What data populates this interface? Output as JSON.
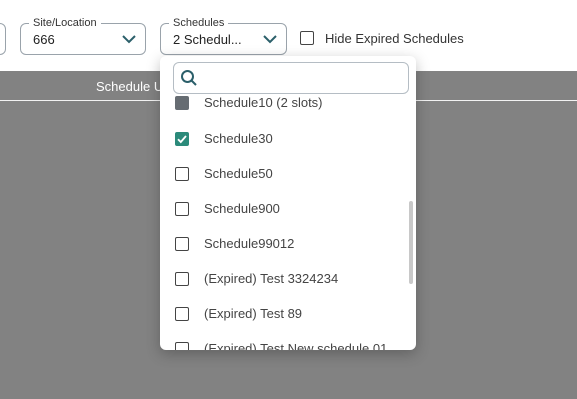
{
  "filters": {
    "site_location": {
      "label": "Site/Location",
      "value": "666"
    },
    "schedules": {
      "label": "Schedules",
      "value": "2 Schedul..."
    },
    "hide_expired_label": "Hide Expired Schedules"
  },
  "table": {
    "header_partial": "Schedule U"
  },
  "dropdown": {
    "search_placeholder": "",
    "options": [
      {
        "label": "Schedule10 (2 slots)",
        "state": "partial"
      },
      {
        "label": "Schedule30",
        "state": "checked"
      },
      {
        "label": "Schedule50",
        "state": "unchecked"
      },
      {
        "label": "Schedule900",
        "state": "unchecked"
      },
      {
        "label": "Schedule99012",
        "state": "unchecked"
      },
      {
        "label": "(Expired) Test 3324234",
        "state": "unchecked"
      },
      {
        "label": "(Expired) Test 89",
        "state": "unchecked"
      },
      {
        "label": "(Expired) Test New schedule 01",
        "state": "unchecked"
      }
    ]
  },
  "colors": {
    "accent": "#2b8a7a",
    "overlay_gray": "#828282"
  }
}
